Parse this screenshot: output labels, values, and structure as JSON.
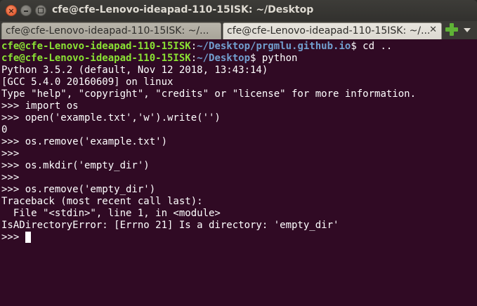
{
  "window": {
    "title": "cfe@cfe-Lenovo-ideapad-110-15ISK: ~/Desktop"
  },
  "tabs": [
    {
      "label": "cfe@cfe-Lenovo-ideapad-110-15ISK: ~/...",
      "active": false
    },
    {
      "label": "cfe@cfe-Lenovo-ideapad-110-15ISK: ~/...",
      "active": true
    }
  ],
  "terminal": {
    "prompt_user": "cfe@cfe-Lenovo-ideapad-110-15ISK",
    "prompt_sep": ":",
    "line1_path": "~/Desktop/prgmlu.github.io",
    "line1_cmd": "$ cd ..",
    "line2_path": "~/Desktop",
    "line2_cmd": "$ python",
    "output": [
      "Python 3.5.2 (default, Nov 12 2018, 13:43:14)",
      "[GCC 5.4.0 20160609] on linux",
      "Type \"help\", \"copyright\", \"credits\" or \"license\" for more information.",
      ">>> import os",
      ">>> open('example.txt','w').write('')",
      "0",
      ">>> os.remove('example.txt')",
      ">>>",
      ">>> os.mkdir('empty_dir')",
      ">>>",
      ">>> os.remove('empty_dir')",
      "Traceback (most recent call last):",
      "  File \"<stdin>\", line 1, in <module>",
      "IsADirectoryError: [Errno 21] Is a directory: 'empty_dir'"
    ],
    "current_prompt": ">>> "
  },
  "colors": {
    "terminal_bg": "#300a24",
    "prompt_user": "#8ae234",
    "prompt_path": "#729fcf",
    "text": "#ffffff"
  }
}
